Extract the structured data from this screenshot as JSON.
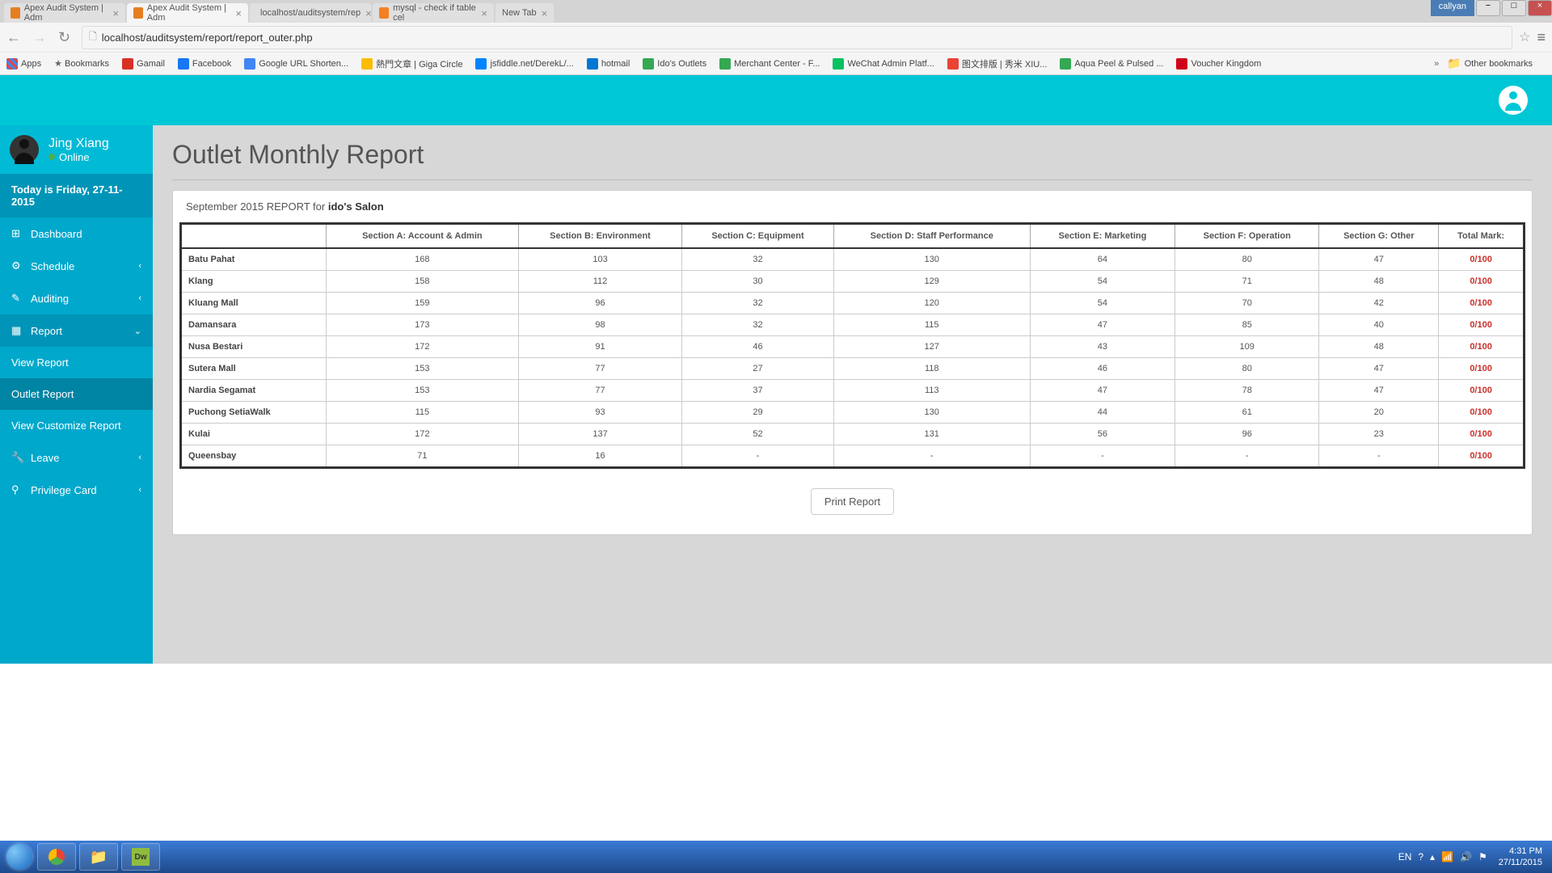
{
  "browser": {
    "tabs": [
      {
        "label": "Apex Audit System | Adm",
        "active": false
      },
      {
        "label": "Apex Audit System | Adm",
        "active": true
      },
      {
        "label": "localhost/auditsystem/rep",
        "active": false
      },
      {
        "label": "mysql - check if table cel",
        "active": false
      },
      {
        "label": "New Tab",
        "active": false
      }
    ],
    "user_badge": "callyan",
    "url": "localhost/auditsystem/report/report_outer.php",
    "bookmarks": {
      "apps": "Apps",
      "bookmarks": "Bookmarks",
      "gamail": "Gamail",
      "facebook": "Facebook",
      "google_url": "Google URL Shorten...",
      "giga": "熱門文章 | Giga Circle",
      "jsfiddle": "jsfiddle.net/DerekL/...",
      "hotmail": "hotmail",
      "ido": "Ido's Outlets",
      "merchant": "Merchant Center - F...",
      "wechat": "WeChat Admin Platf...",
      "cn": "图文排版 | 秀米 XIU...",
      "aqua": "Aqua Peel & Pulsed ...",
      "vk": "Voucher Kingdom",
      "other": "Other bookmarks"
    }
  },
  "sidebar": {
    "user_name": "Jing Xiang",
    "user_status": "Online",
    "date_label": "Today is Friday, 27-11-2015",
    "items": {
      "dashboard": "Dashboard",
      "schedule": "Schedule",
      "auditing": "Auditing",
      "report": "Report",
      "view_report": "View Report",
      "outlet_report": "Outlet Report",
      "customize_report": "View Customize Report",
      "leave": "Leave",
      "privilege": "Privilege Card"
    }
  },
  "content": {
    "title": "Outlet Monthly Report",
    "subtitle_prefix": "September 2015 REPORT for ",
    "subtitle_bold": "ido's Salon",
    "columns": [
      "",
      "Section A: Account & Admin",
      "Section B: Environment",
      "Section C: Equipment",
      "Section D: Staff Performance",
      "Section E: Marketing",
      "Section F: Operation",
      "Section G: Other",
      "Total Mark:"
    ],
    "rows": [
      {
        "name": "Batu Pahat",
        "a": "168",
        "b": "103",
        "c": "32",
        "d": "130",
        "e": "64",
        "f": "80",
        "g": "47",
        "total": "0/100"
      },
      {
        "name": "Klang",
        "a": "158",
        "b": "112",
        "c": "30",
        "d": "129",
        "e": "54",
        "f": "71",
        "g": "48",
        "total": "0/100"
      },
      {
        "name": "Kluang Mall",
        "a": "159",
        "b": "96",
        "c": "32",
        "d": "120",
        "e": "54",
        "f": "70",
        "g": "42",
        "total": "0/100"
      },
      {
        "name": "Damansara",
        "a": "173",
        "b": "98",
        "c": "32",
        "d": "115",
        "e": "47",
        "f": "85",
        "g": "40",
        "total": "0/100"
      },
      {
        "name": "Nusa Bestari",
        "a": "172",
        "b": "91",
        "c": "46",
        "d": "127",
        "e": "43",
        "f": "109",
        "g": "48",
        "total": "0/100"
      },
      {
        "name": "Sutera Mall",
        "a": "153",
        "b": "77",
        "c": "27",
        "d": "118",
        "e": "46",
        "f": "80",
        "g": "47",
        "total": "0/100"
      },
      {
        "name": "Nardia Segamat",
        "a": "153",
        "b": "77",
        "c": "37",
        "d": "113",
        "e": "47",
        "f": "78",
        "g": "47",
        "total": "0/100"
      },
      {
        "name": "Puchong SetiaWalk",
        "a": "115",
        "b": "93",
        "c": "29",
        "d": "130",
        "e": "44",
        "f": "61",
        "g": "20",
        "total": "0/100"
      },
      {
        "name": "Kulai",
        "a": "172",
        "b": "137",
        "c": "52",
        "d": "131",
        "e": "56",
        "f": "96",
        "g": "23",
        "total": "0/100"
      },
      {
        "name": "Queensbay",
        "a": "71",
        "b": "16",
        "c": "-",
        "d": "-",
        "e": "-",
        "f": "-",
        "g": "-",
        "total": "0/100"
      }
    ],
    "print_label": "Print Report"
  },
  "taskbar": {
    "lang": "EN",
    "time": "4:31 PM",
    "date": "27/11/2015"
  }
}
